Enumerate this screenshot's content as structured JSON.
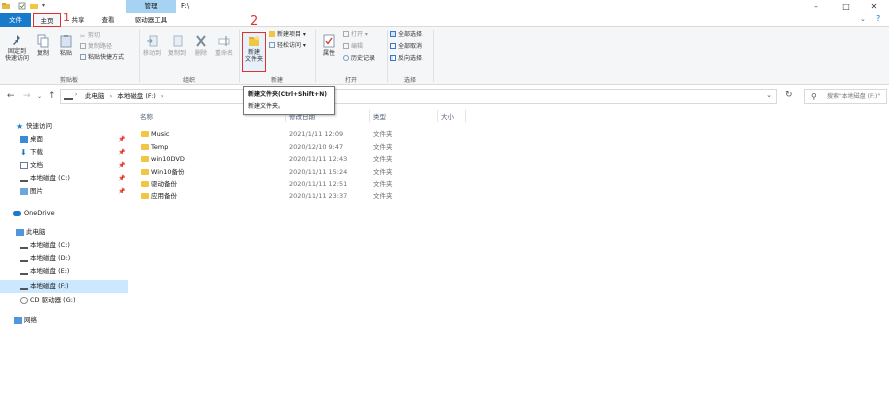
{
  "titlebar": {
    "manage_label": "管理",
    "path_title": "F:\\",
    "minimize": "–",
    "maximize": "□",
    "close": "✕"
  },
  "tabs": {
    "file": "文件",
    "home": "主页",
    "share": "共享",
    "view": "查看",
    "drive_tools": "驱动器工具"
  },
  "annotations": {
    "step1": "1",
    "step2": "2"
  },
  "ribbon": {
    "clipboard": {
      "pin_quick": "固定到\n快速访问",
      "copy": "复制",
      "paste": "粘贴",
      "cut": "剪切",
      "copy_path": "复制路径",
      "paste_shortcut": "粘贴快捷方式",
      "group_label": "剪贴板"
    },
    "organize": {
      "move_to": "移动到",
      "copy_to": "复制到",
      "delete": "删除",
      "rename": "重命名",
      "group_label": "组织"
    },
    "new": {
      "new_folder": "新建\n文件夹",
      "new_item": "新建项目",
      "easy_access": "轻松访问",
      "group_label": "新建"
    },
    "open": {
      "properties": "属性",
      "open": "打开",
      "edit": "编辑",
      "history": "历史记录",
      "group_label": "打开"
    },
    "select": {
      "select_all": "全部选择",
      "select_none": "全部取消",
      "invert": "反向选择",
      "group_label": "选择"
    }
  },
  "tooltip": {
    "title": "新建文件夹(Ctrl+Shift+N)",
    "desc": "新建文件夹。"
  },
  "address": {
    "crumb1": "此电脑",
    "crumb2": "本地磁盘 (F:)",
    "search_placeholder": "搜索\"本地磁盘 (F:)\""
  },
  "nav": {
    "quick_access": "快速访问",
    "desktop": "桌面",
    "downloads": "下载",
    "documents": "文档",
    "disk_c_quick": "本地磁盘 (C:)",
    "pictures": "图片",
    "onedrive": "OneDrive",
    "this_pc": "此电脑",
    "disk_c": "本地磁盘 (C:)",
    "disk_d": "本地磁盘 (D:)",
    "disk_e": "本地磁盘 (E:)",
    "disk_f": "本地磁盘 (F:)",
    "cd_drive": "CD 驱动器 (G:)",
    "network": "网络"
  },
  "columns": {
    "name": "名称",
    "date": "修改日期",
    "type": "类型",
    "size": "大小"
  },
  "files": [
    {
      "name": "Music",
      "date": "2021/1/11 12:09",
      "type": "文件夹"
    },
    {
      "name": "Temp",
      "date": "2020/12/10 9:47",
      "type": "文件夹"
    },
    {
      "name": "win10DVD",
      "date": "2020/11/11 12:43",
      "type": "文件夹"
    },
    {
      "name": "Win10备份",
      "date": "2020/11/11 15:24",
      "type": "文件夹"
    },
    {
      "name": "驱动备份",
      "date": "2020/11/11 12:51",
      "type": "文件夹"
    },
    {
      "name": "应用备份",
      "date": "2020/11/11 23:37",
      "type": "文件夹"
    }
  ],
  "colors": {
    "file_tab": "#1979ca",
    "manage_tab": "#a6d3f4",
    "highlight_red": "#e03030",
    "folder": "#f0c644",
    "selection": "#cce8ff"
  }
}
